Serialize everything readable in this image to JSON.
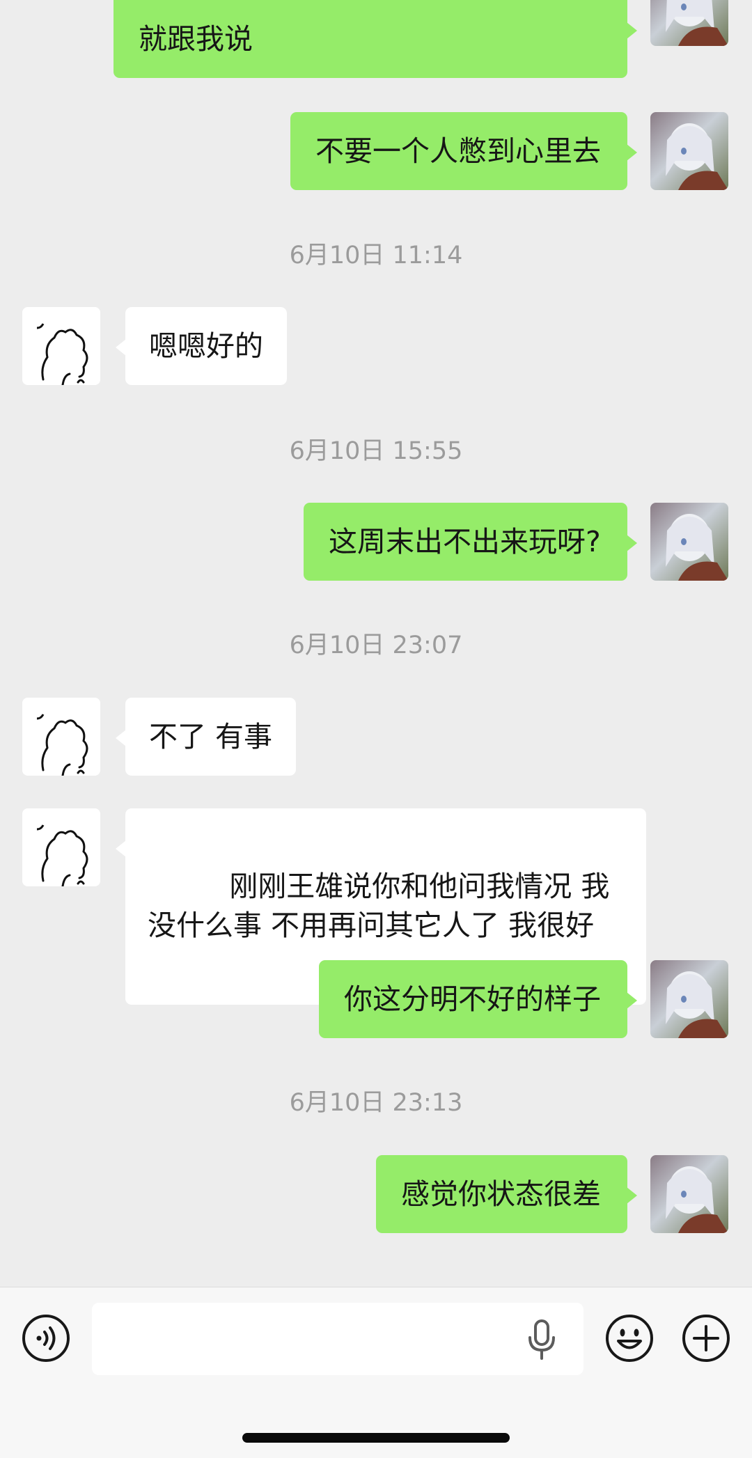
{
  "messages": [
    {
      "side": "self",
      "text": "就跟我说"
    },
    {
      "side": "self",
      "text": "不要一个人憋到心里去"
    },
    {
      "time": "6月10日 11:14"
    },
    {
      "side": "other",
      "text": "嗯嗯好的"
    },
    {
      "time": "6月10日 15:55"
    },
    {
      "side": "self",
      "text": "这周末出不出来玩呀?"
    },
    {
      "time": "6月10日 23:07"
    },
    {
      "side": "other",
      "text": "不了 有事"
    },
    {
      "side": "other",
      "text": " 刚刚王雄说你和他问我情况 我没什么事 不用再问其它人了 我很好"
    },
    {
      "side": "self",
      "text": "你这分明不好的样子"
    },
    {
      "time": "6月10日 23:13"
    },
    {
      "side": "self",
      "text": "感觉你状态很差"
    }
  ],
  "input": {
    "placeholder": "",
    "value": ""
  },
  "icons": {
    "voice": "voice-mode-icon",
    "mic": "microphone-icon",
    "emoji": "emoji-icon",
    "plus": "plus-icon"
  },
  "colors": {
    "self_bubble": "#95ec69",
    "other_bubble": "#ffffff",
    "background": "#ededed",
    "timestamp": "#9b9b9b"
  }
}
